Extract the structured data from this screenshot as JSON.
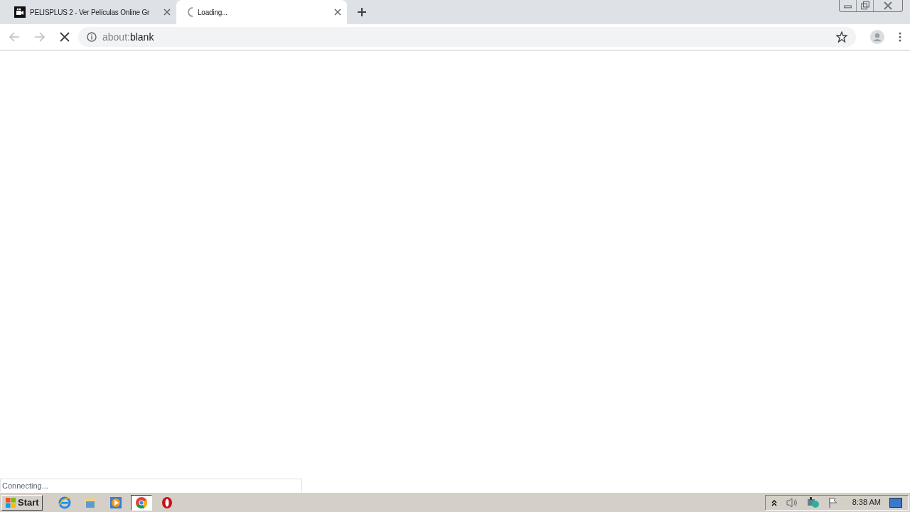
{
  "tabs": [
    {
      "title": "PELISPLUS 2 - Ver Películas Online Gr",
      "selected": false,
      "loading": false
    },
    {
      "title": "Loading...",
      "selected": true,
      "loading": true
    }
  ],
  "toolbar": {
    "url_scheme": "about:",
    "url_rest": "blank"
  },
  "status_bubble": "Connecting...",
  "taskbar": {
    "start": "Start",
    "apps": [
      {
        "kind": "ie",
        "selected": false
      },
      {
        "kind": "explorer",
        "selected": false
      },
      {
        "kind": "media",
        "selected": false
      },
      {
        "kind": "chrome",
        "selected": true
      },
      {
        "kind": "opera",
        "selected": false
      }
    ],
    "clock": "8:38 AM"
  }
}
